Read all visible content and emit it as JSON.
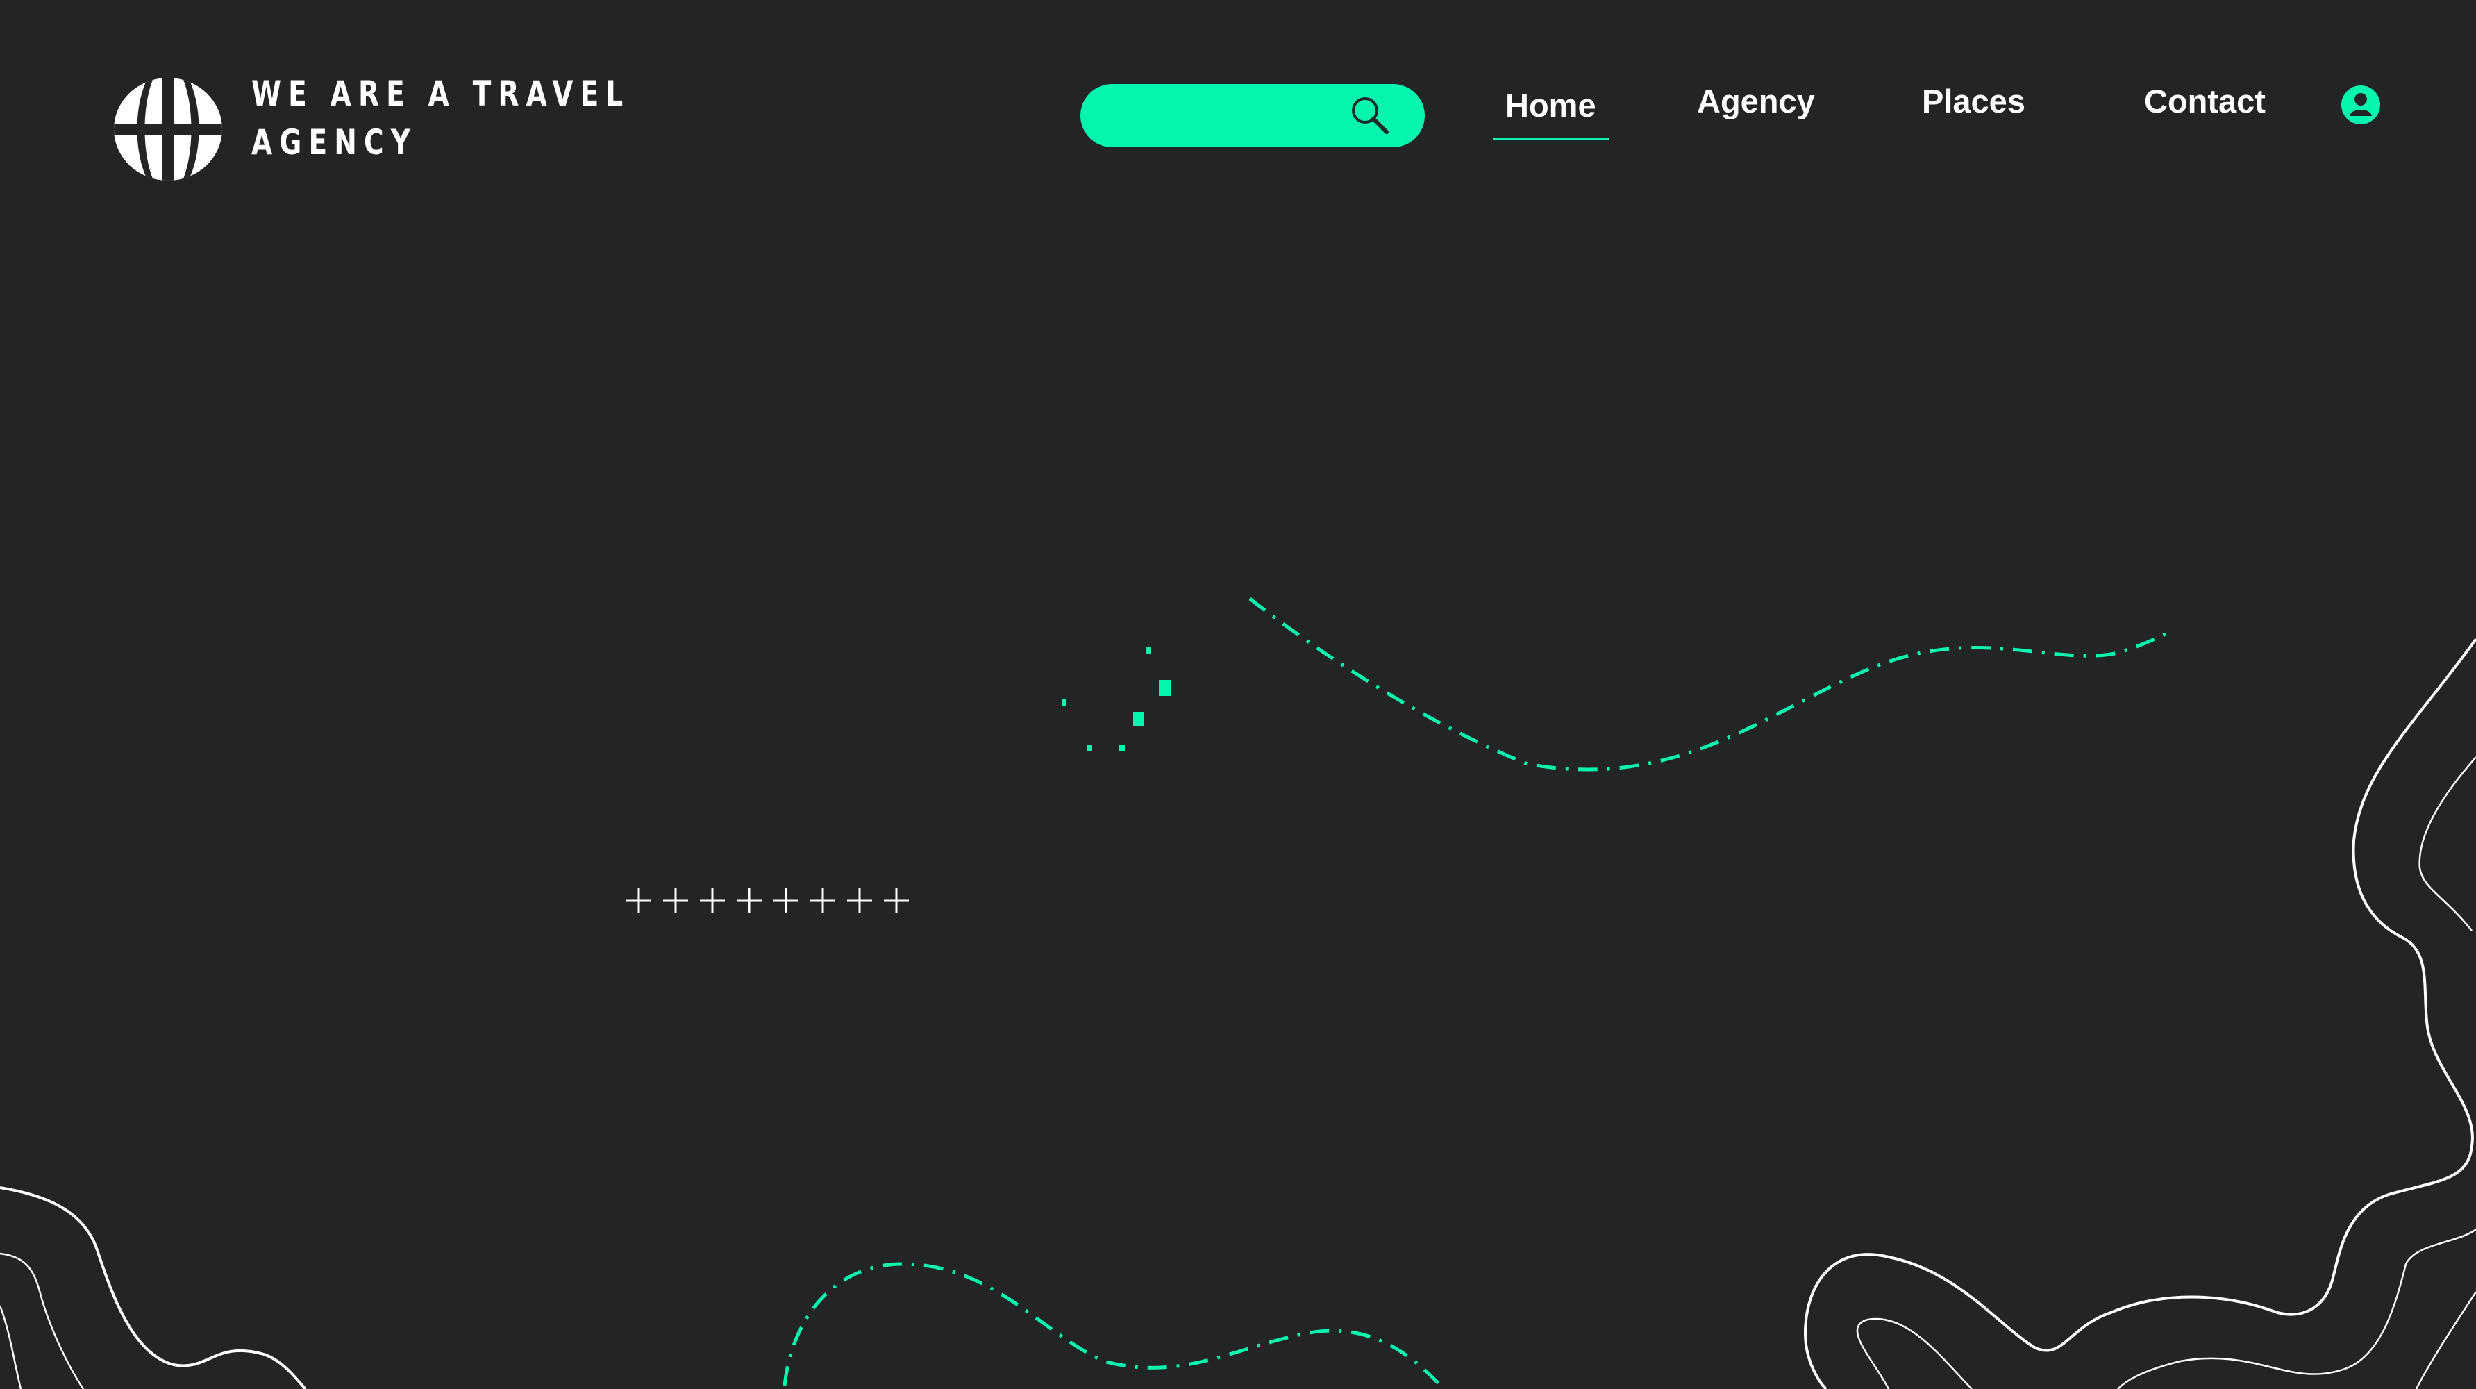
{
  "header": {
    "brand_lines": [
      "WE ARE A TRAVEL",
      "AGENCY"
    ],
    "logo_icon": "globe-icon"
  },
  "search": {
    "icon": "search-icon",
    "color": "#05f5ae"
  },
  "nav": {
    "items": [
      {
        "label": "Home",
        "active": true
      },
      {
        "label": "Agency",
        "active": false
      },
      {
        "label": "Places",
        "active": false
      },
      {
        "label": "Contact",
        "active": false
      }
    ],
    "user_icon": "user-account-icon"
  },
  "theme": {
    "background": "#232426",
    "accent": "#05f5ae",
    "line": "#ffffff"
  },
  "decor": {
    "plus_row": "++++++++"
  }
}
